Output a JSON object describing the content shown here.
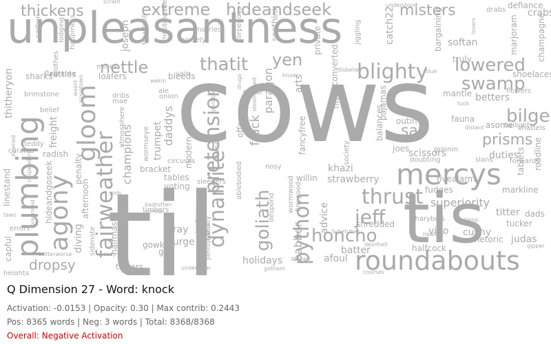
{
  "colors": {
    "word": "#aaaaaa",
    "background": "#ffffff",
    "title": "#111111",
    "stats": "#666666",
    "overall": "#cc0000"
  },
  "cloud_words": [
    "cows",
    "til",
    "tis",
    "unpleasantness",
    "mercys",
    "roundabouts",
    "plumbing",
    "agony",
    "gloom",
    "fairweather",
    "python",
    "dynamite",
    "pretension",
    "thrust",
    "honcho",
    "blighty",
    "nettle",
    "thatit",
    "bilge",
    "swamp",
    "lowered",
    "extreme",
    "hideandseek",
    "misters",
    "thickens",
    "yen",
    "sav",
    "prisms",
    "jeff",
    "goliath",
    "superiority",
    "dropsy",
    "holidays",
    "afoul",
    "batter",
    "shredded",
    "babber",
    "dads",
    "tucker",
    "judas",
    "vino",
    "cushy",
    "frack",
    "paragon",
    "champions",
    "daddys",
    "bray",
    "purge",
    "gowk",
    "gtfo",
    "voting",
    "tables",
    "bracket",
    "khazi",
    "strawberry",
    "willin",
    "fancyfree",
    "nosy",
    "scissors",
    "outin",
    "fauna",
    "betters",
    "duties",
    "fudges",
    "fivealarm",
    "markline",
    "crabs",
    "defiance",
    "champagne",
    "softan",
    "truly",
    "joseph",
    "sharks",
    "rattles",
    "loafers",
    "freight",
    "radish",
    "penalty",
    "diving",
    "capful",
    "hideandgoseek",
    "linestand",
    "thitheryon",
    "ablebodied",
    "liability",
    "inviting",
    "despond",
    "wormwood",
    "advice",
    "balances",
    "pajamas",
    "arts",
    "fittest",
    "converted",
    "seethink",
    "catch22",
    "society",
    "joes",
    "trumpet",
    "wormseye",
    "terrors",
    "modern",
    "bleeds",
    "shoelaces",
    "titter",
    "rhetoric",
    "halfmast",
    "tatters",
    "afternoon",
    "sidenote",
    "offence",
    "doubting",
    "mantle",
    "asome",
    "grinnin",
    "slans",
    "halfcock",
    "charybdis",
    "tablets",
    "roadline",
    "twilight",
    "chattels",
    "flowers",
    "forwards",
    "marjoram",
    "bargaining",
    "understood",
    "jiggling",
    "private",
    "torpedoes",
    "married",
    "anxiety",
    "vain",
    "dribs",
    "mae",
    "ale",
    "onion",
    "lodging",
    "carbon",
    "happiness",
    "treadmill",
    "mobbrigade",
    "scram",
    "atmosphere",
    "circuses",
    "timbers",
    "sods",
    "errors",
    "taws",
    "heights",
    "curates",
    "teddy",
    "belief",
    "brimstone",
    "flagrante",
    "sorrow",
    "badrotten",
    "appointment",
    "pennsylvania",
    "gotham",
    "courses",
    "durned",
    "devilhell",
    "tubetubes",
    "finegood",
    "sleepers",
    "kisser",
    "gipper",
    "healthy",
    "damp",
    "slue",
    "lovers",
    "drabs",
    "tuck",
    "distant",
    "freefall",
    "steamspeed",
    "disbelief",
    "wekin",
    "mines",
    "clothes",
    "alongtown",
    "wasnt",
    "drugs",
    "suspenders",
    "dawned",
    "betterworse",
    "nosey",
    "forearmed",
    "parables",
    "underwear",
    "se"
  ],
  "caption": {
    "title": "Q Dimension 27 - Word: knock",
    "stats_line1": "Activation: -0.0153 | Opacity: 0.30 | Max contrib: 0.2443",
    "stats_line2": "Pos: 8365 words | Neg: 3 words | Total: 8368/8368",
    "overall": "Overall: Negative Activation"
  }
}
